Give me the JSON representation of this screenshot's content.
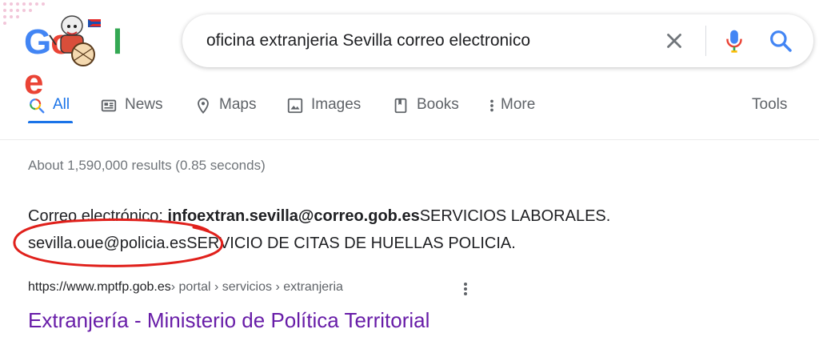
{
  "logo": {
    "letters": [
      "G",
      "o",
      "o",
      "g",
      "l",
      "e"
    ],
    "letter_colors": [
      "#4285f4",
      "#ea4335",
      "#fbbc05",
      "#4285f4",
      "#34a853",
      "#ea4335"
    ]
  },
  "search": {
    "query": "oficina extranjeria Sevilla correo electronico"
  },
  "tabs": [
    {
      "label": "All",
      "icon": "search-icon",
      "active": true
    },
    {
      "label": "News",
      "icon": "news-icon"
    },
    {
      "label": "Maps",
      "icon": "map-pin-icon"
    },
    {
      "label": "Images",
      "icon": "image-icon"
    },
    {
      "label": "Books",
      "icon": "book-icon"
    },
    {
      "label": "More",
      "icon": "kebab-icon"
    }
  ],
  "tools_label": "Tools",
  "results": {
    "stats": "About 1,590,000 results (0.85 seconds)",
    "snippet": {
      "line1_prefix": "Correo electrónico: ",
      "line1_email": "infoextran.sevilla@correo.gob.es",
      "line1_suffix": "SERVICIOS LABORALES.",
      "line2_email": "sevilla.oue@policia.es",
      "line2_suffix": "SERVICIO DE CITAS DE HUELLAS POLICIA."
    },
    "cite": {
      "domain": "https://www.mptfp.gob.es",
      "path": " › portal › servicios › extranjeria"
    },
    "title": "Extranjería - Ministerio de Política Territorial"
  },
  "colors": {
    "accent": "#1a73e8",
    "visited_link": "#681da8",
    "annotation": "#e0201b"
  }
}
